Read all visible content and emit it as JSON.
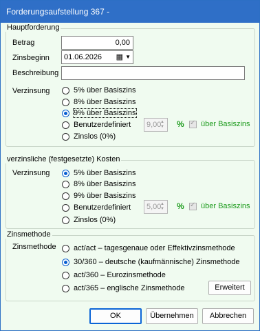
{
  "window": {
    "title": "Forderungsaufstellung 367 -"
  },
  "haupt": {
    "title": "Hauptforderung",
    "betrag_label": "Betrag",
    "betrag_value": "0,00",
    "zinsbeginn_label": "Zinsbeginn",
    "zinsbeginn_value": "01.06.2026",
    "beschreibung_label": "Beschreibung",
    "beschreibung_value": "",
    "verzinsung_label": "Verzinsung",
    "options": [
      "5% über Basiszins",
      "8% über Basiszins",
      "9% über Basiszins",
      "Benutzerdefiniert",
      "Zinslos (0%)"
    ],
    "selected": 2,
    "custom_value": "9,00",
    "pct": "%",
    "ueber_label": "über Basiszins"
  },
  "kosten": {
    "title": "verzinsliche (festgesetzte) Kosten",
    "verzinsung_label": "Verzinsung",
    "options": [
      "5% über Basiszins",
      "8% über Basiszins",
      "9% über Basiszins",
      "Benutzerdefiniert",
      "Zinslos (0%)"
    ],
    "selected": 0,
    "custom_value": "5,00",
    "pct": "%",
    "ueber_label": "über Basiszins"
  },
  "zinsmethode": {
    "title": "Zinsmethode",
    "label": "Zinsmethode",
    "options": [
      "act/act – tagesgenaue oder Effektivzinsmethode",
      "30/360 – deutsche (kaufmännische) Zinsmethode",
      "act/360 – Eurozinsmethode",
      "act/365 – englische Zinsmethode"
    ],
    "selected": 1,
    "erweitert": "Erweitert"
  },
  "buttons": {
    "ok": "OK",
    "uebernehmen": "Übernehmen",
    "abbrechen": "Abbrechen"
  },
  "colors": {
    "titlebar": "#2f6fc7",
    "background": "#f0fbf0",
    "accent_green": "#1a9a1a",
    "radio_blue": "#0a5fd0"
  }
}
